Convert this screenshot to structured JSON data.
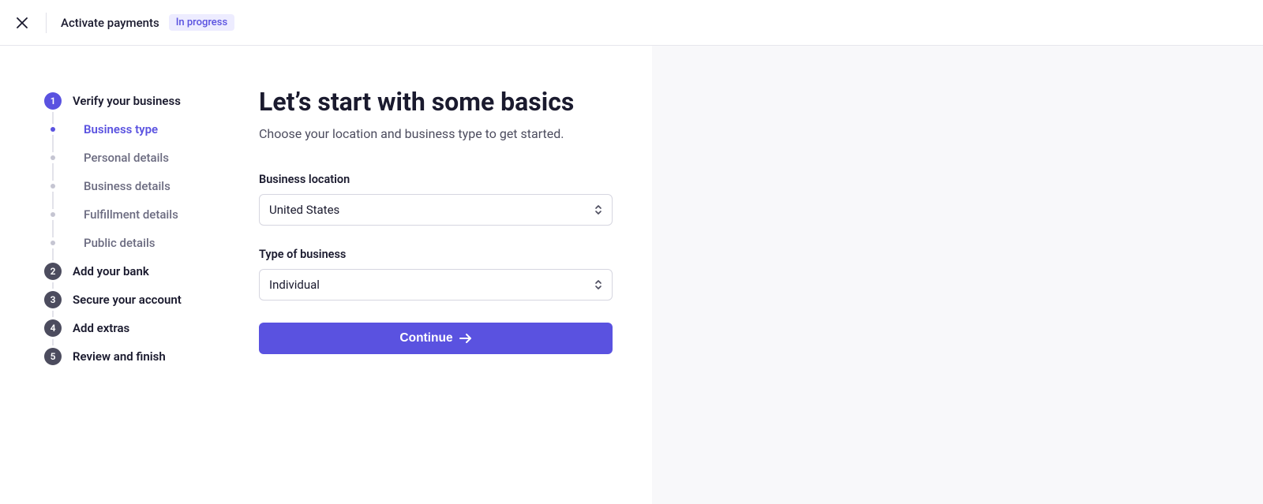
{
  "header": {
    "title": "Activate payments",
    "status": "In progress"
  },
  "nav": {
    "steps": [
      {
        "num": "1",
        "label": "Verify your business",
        "state": "active",
        "substeps": [
          {
            "label": "Business type",
            "active": true
          },
          {
            "label": "Personal details",
            "active": false
          },
          {
            "label": "Business details",
            "active": false
          },
          {
            "label": "Fulfillment details",
            "active": false
          },
          {
            "label": "Public details",
            "active": false
          }
        ]
      },
      {
        "num": "2",
        "label": "Add your bank",
        "state": "pending"
      },
      {
        "num": "3",
        "label": "Secure your account",
        "state": "pending"
      },
      {
        "num": "4",
        "label": "Add extras",
        "state": "pending"
      },
      {
        "num": "5",
        "label": "Review and finish",
        "state": "pending"
      }
    ]
  },
  "form": {
    "heading": "Let’s start with some basics",
    "subheading": "Choose your location and business type to get started.",
    "location_label": "Business location",
    "location_value": "United States",
    "type_label": "Type of business",
    "type_value": "Individual",
    "continue_label": "Continue"
  }
}
